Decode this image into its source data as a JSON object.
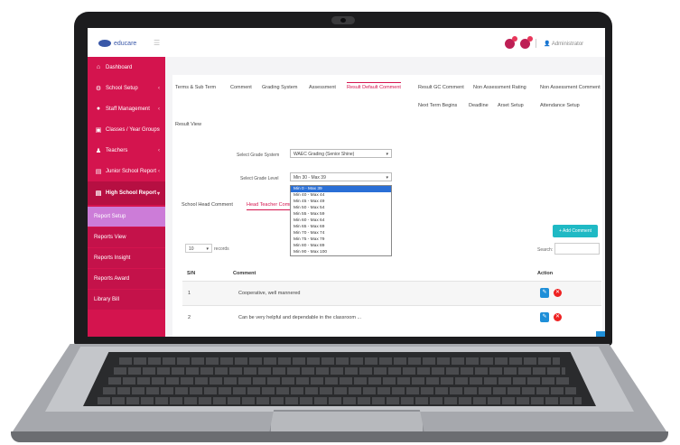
{
  "topbar": {
    "logo_text": "educare",
    "username": "Administrator"
  },
  "sidebar": {
    "items": [
      {
        "label": "Dashboard",
        "icon": "home-icon"
      },
      {
        "label": "School Setup",
        "icon": "gear-icon"
      },
      {
        "label": "Staff Management",
        "icon": "staff-icon"
      },
      {
        "label": "Classes / Year Groups",
        "icon": "classes-icon"
      },
      {
        "label": "Teachers",
        "icon": "teacher-icon"
      },
      {
        "label": "Junior School Report",
        "icon": "report-icon"
      },
      {
        "label": "High School Report",
        "icon": "report-icon"
      }
    ],
    "subitems": [
      {
        "label": "Report Setup"
      },
      {
        "label": "Reports View"
      },
      {
        "label": "Reports Insight"
      },
      {
        "label": "Reports Award"
      },
      {
        "label": "Library Bill"
      }
    ]
  },
  "tabs_row1": [
    "Terms & Sub Term",
    "Comment",
    "Grading System",
    "Assessment",
    "Result Default Comment",
    "Result GC Comment",
    "Non Assessment Rating",
    "Non Assessment Comment"
  ],
  "tabs_row2": [
    "Next Term Begins",
    "Deadline",
    "Arset Setup",
    "Attendance Setup"
  ],
  "result_view": "Result View",
  "form": {
    "grade_system_label": "Select Grade System",
    "grade_system_value": "WAEC Grading (Senior Shine)",
    "grade_level_label": "Select Grade Level",
    "grade_level_value": "Min 30 - Max 39"
  },
  "dropdown_options": [
    "Min 0 - Max 39",
    "Min 40 - Max 44",
    "Min 45 - Max 49",
    "Min 50 - Max 54",
    "Min 55 - Max 59",
    "Min 60 - Max 64",
    "Min 65 - Max 69",
    "Min 70 - Max 74",
    "Min 75 - Max 79",
    "Min 80 - Max 89",
    "Min 90 - Max 100"
  ],
  "subtabs": [
    "School Head Comment",
    "Head Teacher Comment"
  ],
  "add_button": "+ Add Comment",
  "table_controls": {
    "length_value": "10",
    "length_suffix": "records",
    "search_label": "Search:"
  },
  "table": {
    "headers": [
      "S/N",
      "Comment",
      "Action"
    ],
    "rows": [
      {
        "sn": "1",
        "comment": "Cooperative, well mannered"
      },
      {
        "sn": "2",
        "comment": "Can be very helpful and dependable in the classroom ..."
      }
    ]
  }
}
